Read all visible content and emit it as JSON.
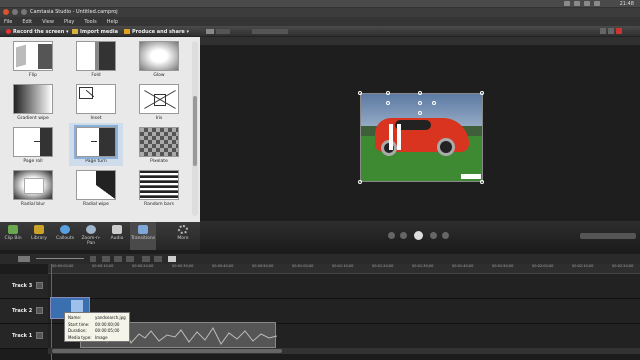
{
  "system": {
    "clock": "21:48"
  },
  "window": {
    "title": "Camtasia Studio - Untitled.camproj"
  },
  "menu": [
    "File",
    "Edit",
    "View",
    "Play",
    "Tools",
    "Help"
  ],
  "toolbar": {
    "record": "Record the screen ▾",
    "import": "Import media",
    "produce": "Produce and share ▾"
  },
  "transitions": [
    {
      "name": "Flip"
    },
    {
      "name": "Fold"
    },
    {
      "name": "Glow"
    },
    {
      "name": "Gradient wipe"
    },
    {
      "name": "Inset"
    },
    {
      "name": "Iris"
    },
    {
      "name": "Page roll"
    },
    {
      "name": "Page turn"
    },
    {
      "name": "Pixelate"
    },
    {
      "name": "Radial blur"
    },
    {
      "name": "Radial wipe"
    },
    {
      "name": "Random bars"
    }
  ],
  "tabs": [
    {
      "label": "Clip Bin",
      "color": "#6aa84f"
    },
    {
      "label": "Library",
      "color": "#c9a227"
    },
    {
      "label": "Callouts",
      "color": "#5aa0e0"
    },
    {
      "label": "Zoom-n-Pan",
      "color": "#9fb5cc"
    },
    {
      "label": "Audio",
      "color": "#cccccc"
    },
    {
      "label": "Transitions",
      "color": "#7fa7d9"
    },
    {
      "label": "More",
      "color": "#bbbbbb"
    }
  ],
  "tracks": [
    {
      "label": "Track 3"
    },
    {
      "label": "Track 2"
    },
    {
      "label": "Track 1"
    }
  ],
  "timeline": {
    "marks": [
      "00:00:00;00",
      "00:00:10;00",
      "00:00:20;00",
      "00:00:30;00",
      "00:00:40;00",
      "00:00:50;00",
      "00:01:00;00",
      "00:01:10;00",
      "00:01:20;00",
      "00:01:30;00",
      "00:01:40;00",
      "00:01:50;00",
      "00:02:00;00",
      "00:02:10;00",
      "00:02:20;00"
    ]
  },
  "tooltip": {
    "name_k": "Name:",
    "name_v": "yandsearch.jpg",
    "start_k": "Start time:",
    "start_v": "00:00:00;00",
    "dur_k": "Duration:",
    "dur_v": "00:00:05;00",
    "type_k": "Media type:",
    "type_v": "Image"
  },
  "colors": {
    "accent": "#d33333",
    "selection": "#cfdceb"
  }
}
